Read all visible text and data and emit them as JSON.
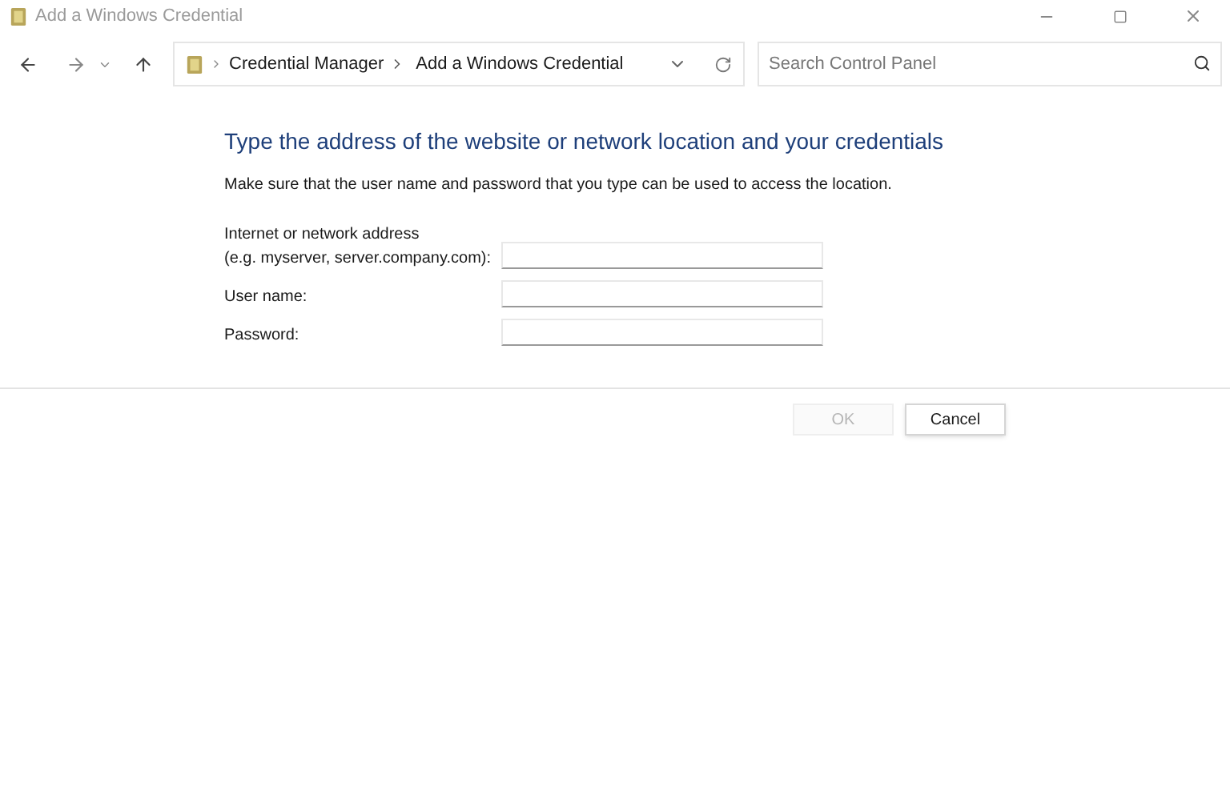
{
  "window": {
    "title": "Add a Windows Credential"
  },
  "address_bar": {
    "path": [
      "Credential Manager",
      "Add a Windows Credential"
    ]
  },
  "search": {
    "placeholder": "Search Control Panel"
  },
  "heading": "Type the address of the website or network location and your credentials",
  "description": "Make sure that the user name and password that you type can be used to access the location.",
  "fields": [
    {
      "label_lines": [
        "Internet or network address",
        "(e.g. myserver, server.company.com):"
      ]
    },
    {
      "label_lines": [
        "User name:"
      ]
    },
    {
      "label_lines": [
        "Password:"
      ]
    }
  ],
  "buttons": [
    {
      "label": "OK",
      "disabled": true
    },
    {
      "label": "Cancel",
      "disabled": false
    }
  ]
}
